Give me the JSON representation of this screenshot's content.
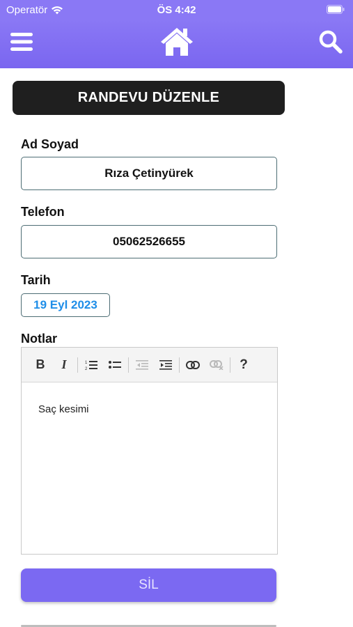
{
  "status_bar": {
    "carrier": "Operatör",
    "time": "ÖS 4:42"
  },
  "navbar": {
    "menu_icon": "hamburger-menu-icon",
    "home_icon": "home-icon",
    "search_icon": "search-icon",
    "color": "#8a78f5"
  },
  "page": {
    "title": "RANDEVU DÜZENLE"
  },
  "form": {
    "name_label": "Ad Soyad",
    "name_value": "Rıza Çetinyürek",
    "phone_label": "Telefon",
    "phone_value": "05062526655",
    "date_label": "Tarih",
    "date_value": "19 Eyl 2023",
    "notes_label": "Notlar",
    "notes_value": "Saç kesimi"
  },
  "editor_toolbar": {
    "bold": "B",
    "italic": "I",
    "help": "?"
  },
  "actions": {
    "delete_label": "SİL",
    "accent": "#7b69f2"
  }
}
